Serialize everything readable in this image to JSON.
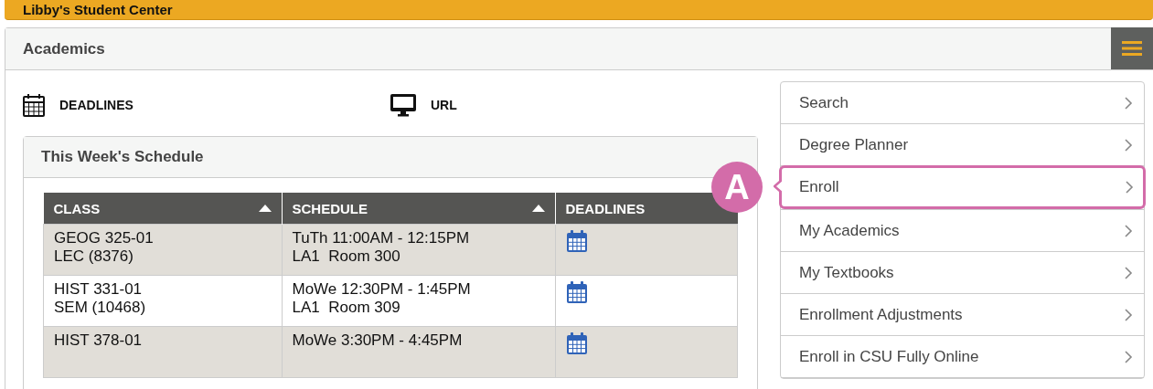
{
  "top_bar": {
    "title": "Libby's Student Center"
  },
  "panel": {
    "title": "Academics"
  },
  "links": [
    {
      "kind": "calendar",
      "label": "DEADLINES"
    },
    {
      "kind": "monitor",
      "label": "URL"
    }
  ],
  "schedule": {
    "title": "This Week's Schedule",
    "columns": [
      {
        "label": "CLASS",
        "sortable": true
      },
      {
        "label": "SCHEDULE",
        "sortable": true
      },
      {
        "label": "DEADLINES",
        "sortable": false
      }
    ],
    "rows": [
      {
        "class": [
          "GEOG 325-01",
          "LEC (8376)"
        ],
        "schedule": [
          "TuTh 11:00AM - 12:15PM",
          "LA1  Room 300"
        ]
      },
      {
        "class": [
          "HIST 331-01",
          "SEM (10468)"
        ],
        "schedule": [
          "MoWe 12:30PM - 1:45PM",
          "LA1  Room 309"
        ]
      },
      {
        "class": [
          "HIST 378-01"
        ],
        "schedule": [
          "MoWe 3:30PM - 4:45PM"
        ]
      }
    ]
  },
  "menu": [
    {
      "label": "Search",
      "selected": false
    },
    {
      "label": "Degree Planner",
      "selected": false
    },
    {
      "label": "Enroll",
      "selected": true,
      "callout": "A"
    },
    {
      "label": "My Academics",
      "selected": false
    },
    {
      "label": "My Textbooks",
      "selected": false
    },
    {
      "label": "Enrollment Adjustments",
      "selected": false
    },
    {
      "label": "Enroll in CSU Fully Online",
      "selected": false
    }
  ]
}
